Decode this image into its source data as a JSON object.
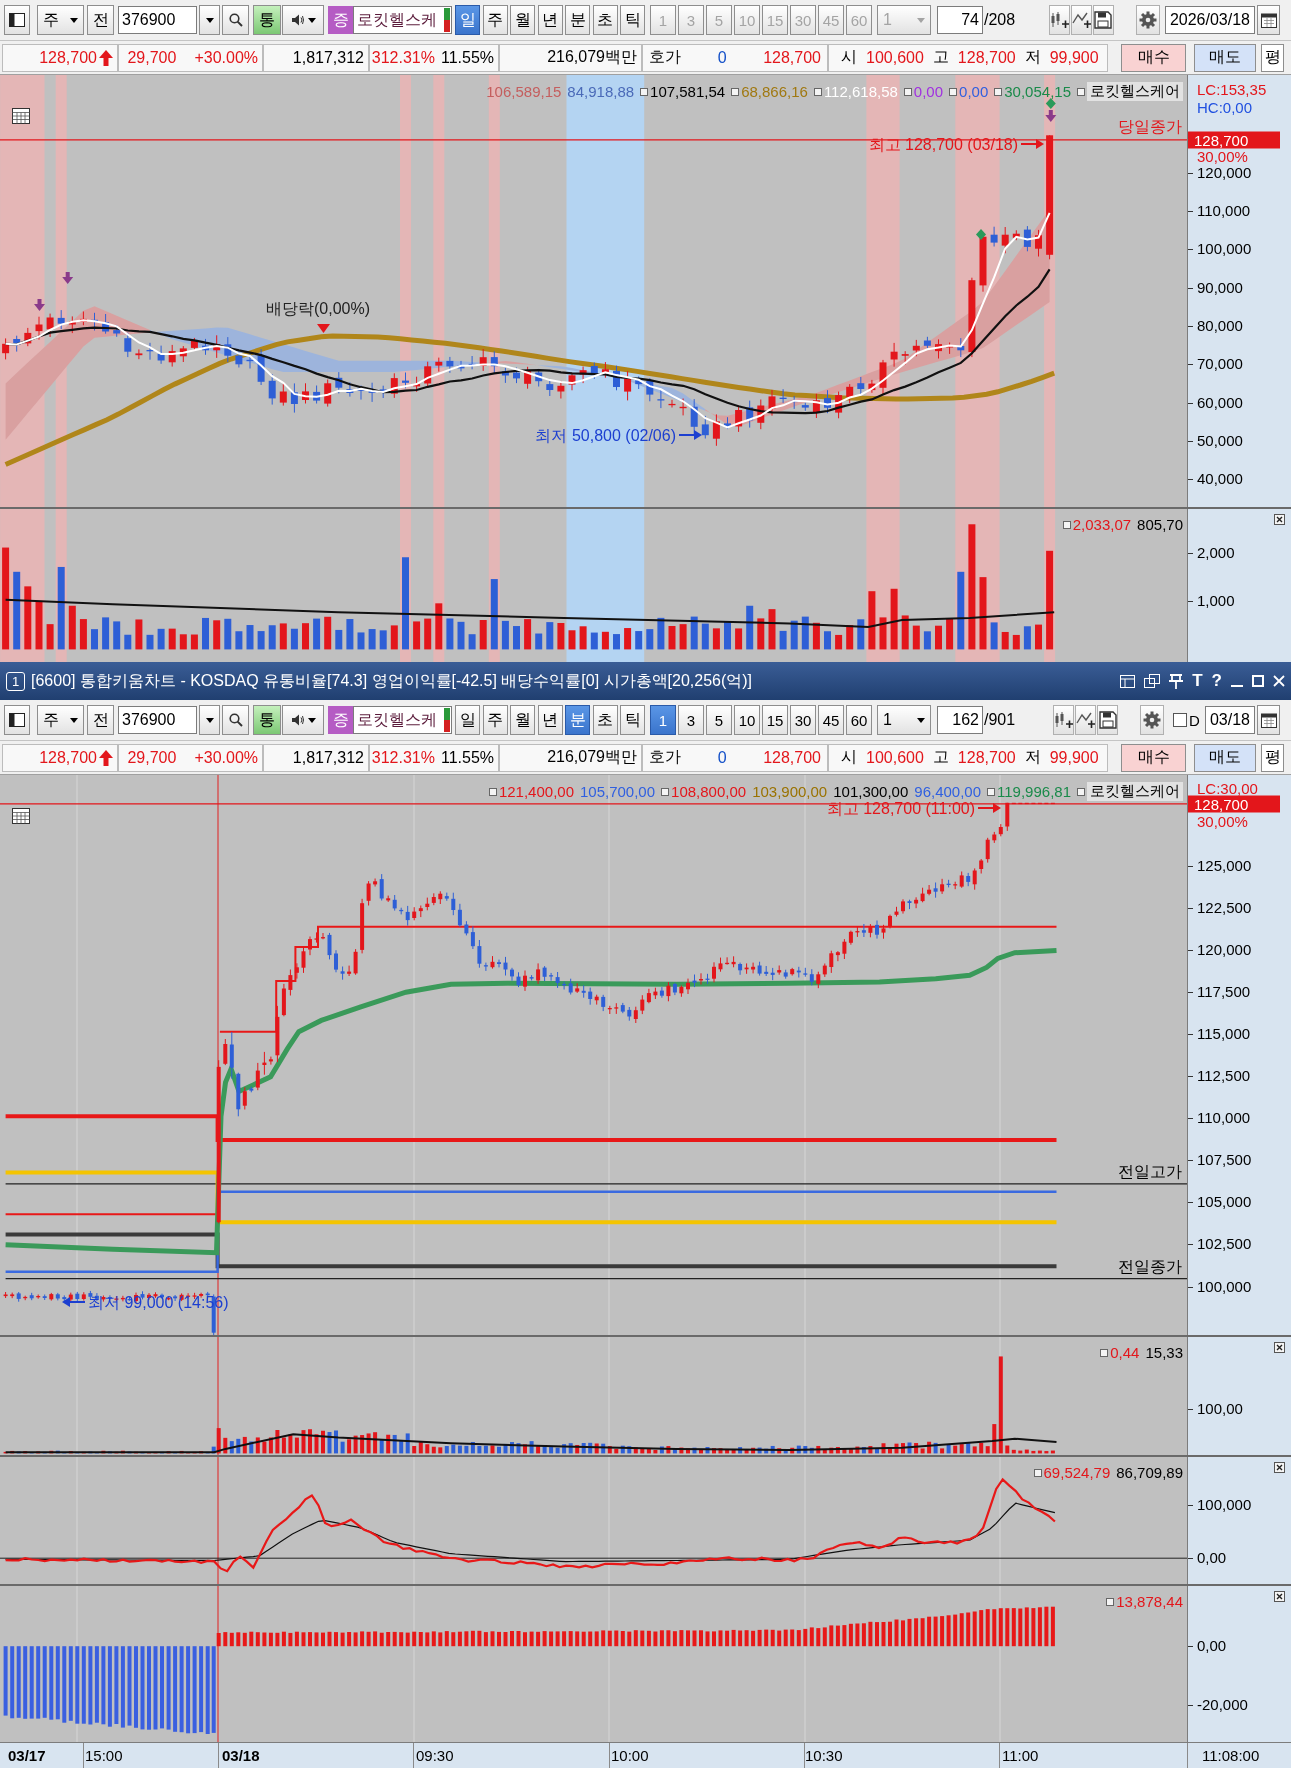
{
  "top_window": {
    "toolbar": {
      "market": "주",
      "scope": "전",
      "code": "376900",
      "volume_toggle": "통",
      "market_badge": "증",
      "stock_name": "로킷헬스케",
      "periods": [
        {
          "label": "일",
          "selected": true
        },
        {
          "label": "주",
          "selected": false
        },
        {
          "label": "월",
          "selected": false
        },
        {
          "label": "년",
          "selected": false
        },
        {
          "label": "분",
          "selected": false
        },
        {
          "label": "초",
          "selected": false
        },
        {
          "label": "틱",
          "selected": false
        }
      ],
      "intervals": [
        {
          "label": "1",
          "selected": false,
          "disabled": true
        },
        {
          "label": "3",
          "selected": false,
          "disabled": true
        },
        {
          "label": "5",
          "selected": false,
          "disabled": true
        },
        {
          "label": "10",
          "selected": false,
          "disabled": true
        },
        {
          "label": "15",
          "selected": false,
          "disabled": true
        },
        {
          "label": "30",
          "selected": false,
          "disabled": true
        },
        {
          "label": "45",
          "selected": false,
          "disabled": true
        },
        {
          "label": "60",
          "selected": false,
          "disabled": true
        }
      ],
      "unit": {
        "value": "1",
        "disabled": true
      },
      "count": "74",
      "total": "/208",
      "date": "2026/03/18"
    },
    "quote_bar": {
      "cells": [
        {
          "items": [
            {
              "text": "128,700",
              "color": "#e3161b",
              "arrow_up": true
            }
          ]
        },
        {
          "items": [
            {
              "text": "29,700",
              "color": "#e3161b"
            },
            {
              "text": "+30.00%",
              "color": "#e3161b"
            }
          ]
        },
        {
          "items": [
            {
              "text": "1,817,312"
            }
          ]
        },
        {
          "items": [
            {
              "text": "312.31%",
              "color": "#e3161b"
            },
            {
              "text": "11.55%"
            }
          ]
        },
        {
          "items": [
            {
              "text": "216,079백만"
            }
          ]
        },
        {
          "items": [
            {
              "text": "호가"
            },
            {
              "text": "0",
              "color": "#1450c8"
            },
            {
              "text": "128,700",
              "color": "#e3161b"
            }
          ]
        },
        {
          "items": [
            {
              "text": "시"
            },
            {
              "text": "100,600",
              "color": "#e3161b"
            },
            {
              "text": "고"
            },
            {
              "text": "128,700",
              "color": "#e3161b"
            },
            {
              "text": "저"
            },
            {
              "text": "99,900",
              "color": "#e3161b"
            }
          ]
        }
      ],
      "buttons": [
        {
          "label": "매수",
          "kind": "buy"
        },
        {
          "label": "매도",
          "kind": "sell"
        },
        {
          "label": "평",
          "kind": "plain"
        }
      ]
    },
    "chart": {
      "legend": [
        {
          "text": "106,589,15",
          "color": "#c45e5e",
          "marker": false
        },
        {
          "text": "84,918,88",
          "color": "#4a6ab8",
          "marker": false
        },
        {
          "text": "107,581,54",
          "color": "#000000",
          "marker": true
        },
        {
          "text": "68,866,16",
          "color": "#a07810",
          "marker": true
        },
        {
          "text": "112,618,58",
          "color": "#ffffff",
          "marker": true
        },
        {
          "text": "0,00",
          "color": "#a030e0",
          "marker": true
        },
        {
          "text": "0,00",
          "color": "#2f5fe0",
          "marker": true
        },
        {
          "text": "30,054,15",
          "color": "#1a8a4a",
          "marker": true
        }
      ],
      "stock_label": "로킷헬스케어",
      "annotations": [
        {
          "kind": "high",
          "text": "최고 128,700 (03/18)"
        },
        {
          "kind": "close",
          "text": "당일종가"
        },
        {
          "kind": "dividend",
          "text": "배당락(0,00%)"
        },
        {
          "kind": "low",
          "text": "최저 50,800 (02/06)"
        }
      ],
      "axis": {
        "lc": "LC:153,35",
        "hc": "HC:0,00",
        "current": "128,700",
        "change": "30,00%",
        "ticks": [
          "120,000",
          "110,000",
          "100,000",
          "90,000",
          "80,000",
          "70,000",
          "60,000",
          "50,000",
          "40,000"
        ]
      },
      "volume_legend": [
        {
          "text": "2,033,07",
          "color": "#e3161b",
          "marker": true
        },
        {
          "text": "805,70",
          "color": "#000000",
          "marker": false
        }
      ],
      "volume_axis": [
        "2,000",
        "1,000"
      ]
    }
  },
  "bottom_window": {
    "title_bar": {
      "number": "1",
      "title": "[6600] 통합키움차트 - KOSDAQ 유통비율[74.3] 영업이익률[-42.5] 배당수익률[0] 시가총액[20,256(억)]",
      "tool_buttons": [
        "T",
        "?"
      ]
    },
    "toolbar": {
      "market": "주",
      "scope": "전",
      "code": "376900",
      "volume_toggle": "통",
      "market_badge": "증",
      "stock_name": "로킷헬스케",
      "periods": [
        {
          "label": "일",
          "selected": false
        },
        {
          "label": "주",
          "selected": false
        },
        {
          "label": "월",
          "selected": false
        },
        {
          "label": "년",
          "selected": false
        },
        {
          "label": "분",
          "selected": true
        },
        {
          "label": "초",
          "selected": false
        },
        {
          "label": "틱",
          "selected": false
        }
      ],
      "intervals": [
        {
          "label": "1",
          "selected": true,
          "disabled": false
        },
        {
          "label": "3",
          "selected": false,
          "disabled": false
        },
        {
          "label": "5",
          "selected": false,
          "disabled": false
        },
        {
          "label": "10",
          "selected": false,
          "disabled": false
        },
        {
          "label": "15",
          "selected": false,
          "disabled": false
        },
        {
          "label": "30",
          "selected": false,
          "disabled": false
        },
        {
          "label": "45",
          "selected": false,
          "disabled": false
        },
        {
          "label": "60",
          "selected": false,
          "disabled": false
        }
      ],
      "unit": {
        "value": "1",
        "disabled": false
      },
      "count": "162",
      "total": "/901",
      "d_checkbox": {
        "label": "D",
        "checked": false
      },
      "date": "03/18"
    },
    "quote_bar": {
      "cells": [
        {
          "items": [
            {
              "text": "128,700",
              "color": "#e3161b",
              "arrow_up": true
            }
          ]
        },
        {
          "items": [
            {
              "text": "29,700",
              "color": "#e3161b"
            },
            {
              "text": "+30.00%",
              "color": "#e3161b"
            }
          ]
        },
        {
          "items": [
            {
              "text": "1,817,312"
            }
          ]
        },
        {
          "items": [
            {
              "text": "312.31%",
              "color": "#e3161b"
            },
            {
              "text": "11.55%"
            }
          ]
        },
        {
          "items": [
            {
              "text": "216,079백만"
            }
          ]
        },
        {
          "items": [
            {
              "text": "호가"
            },
            {
              "text": "0",
              "color": "#1450c8"
            },
            {
              "text": "128,700",
              "color": "#e3161b"
            }
          ]
        },
        {
          "items": [
            {
              "text": "시"
            },
            {
              "text": "100,600",
              "color": "#e3161b"
            },
            {
              "text": "고"
            },
            {
              "text": "128,700",
              "color": "#e3161b"
            },
            {
              "text": "저"
            },
            {
              "text": "99,900",
              "color": "#e3161b"
            }
          ]
        }
      ],
      "buttons": [
        {
          "label": "매수",
          "kind": "buy"
        },
        {
          "label": "매도",
          "kind": "sell"
        },
        {
          "label": "평",
          "kind": "plain"
        }
      ]
    },
    "chart": {
      "legend": [
        {
          "text": "121,400,00",
          "color": "#e3161b",
          "marker": true
        },
        {
          "text": "105,700,00",
          "color": "#2f5fe0",
          "marker": false
        },
        {
          "text": "108,800,00",
          "color": "#e3161b",
          "marker": true
        },
        {
          "text": "103,900,00",
          "color": "#9a7200",
          "marker": false
        },
        {
          "text": "101,300,00",
          "color": "#000000",
          "marker": false
        },
        {
          "text": "96,400,00",
          "color": "#2f5fe0",
          "marker": false
        },
        {
          "text": "119,996,81",
          "color": "#1a8a4a",
          "marker": true
        }
      ],
      "stock_label": "로킷헬스케어",
      "annotations": [
        {
          "kind": "high",
          "text": "최고 128,700 (11:00)"
        },
        {
          "kind": "prev_high",
          "text": "전일고가"
        },
        {
          "kind": "prev_close",
          "text": "전일종가"
        },
        {
          "kind": "low",
          "text": "최저 99,000 (14:56)"
        }
      ],
      "axis": {
        "lc": "LC:30,00",
        "current": "128,700",
        "change": "30,00%",
        "ticks": [
          "125,000",
          "122,500",
          "120,000",
          "117,500",
          "115,000",
          "112,500",
          "110,000",
          "107,500",
          "105,000",
          "102,500",
          "100,000"
        ]
      },
      "volume_legend": [
        {
          "text": "0,44",
          "color": "#e3161b",
          "marker": true
        },
        {
          "text": "15,33",
          "color": "#000000",
          "marker": false
        }
      ],
      "volume_axis": [
        "100,00"
      ],
      "indicator_legend": [
        {
          "text": "69,524,79",
          "color": "#e3161b",
          "marker": true
        },
        {
          "text": "86,709,89",
          "color": "#000000",
          "marker": false
        }
      ],
      "indicator_axis": [
        "100,000",
        "0,00"
      ],
      "histogram_legend": [
        {
          "text": "13,878,44",
          "color": "#e3161b",
          "marker": true
        }
      ],
      "histogram_axis": [
        "0,00",
        "-20,000"
      ],
      "time_axis": [
        {
          "text": "03/17",
          "kind": "date"
        },
        {
          "text": "15:00",
          "kind": "time"
        },
        {
          "text": "03/18",
          "kind": "date"
        },
        {
          "text": "09:30",
          "kind": "time"
        },
        {
          "text": "10:00",
          "kind": "time"
        },
        {
          "text": "10:30",
          "kind": "time"
        },
        {
          "text": "11:00",
          "kind": "time"
        },
        {
          "text": "11:08:00",
          "kind": "time"
        }
      ]
    }
  }
}
